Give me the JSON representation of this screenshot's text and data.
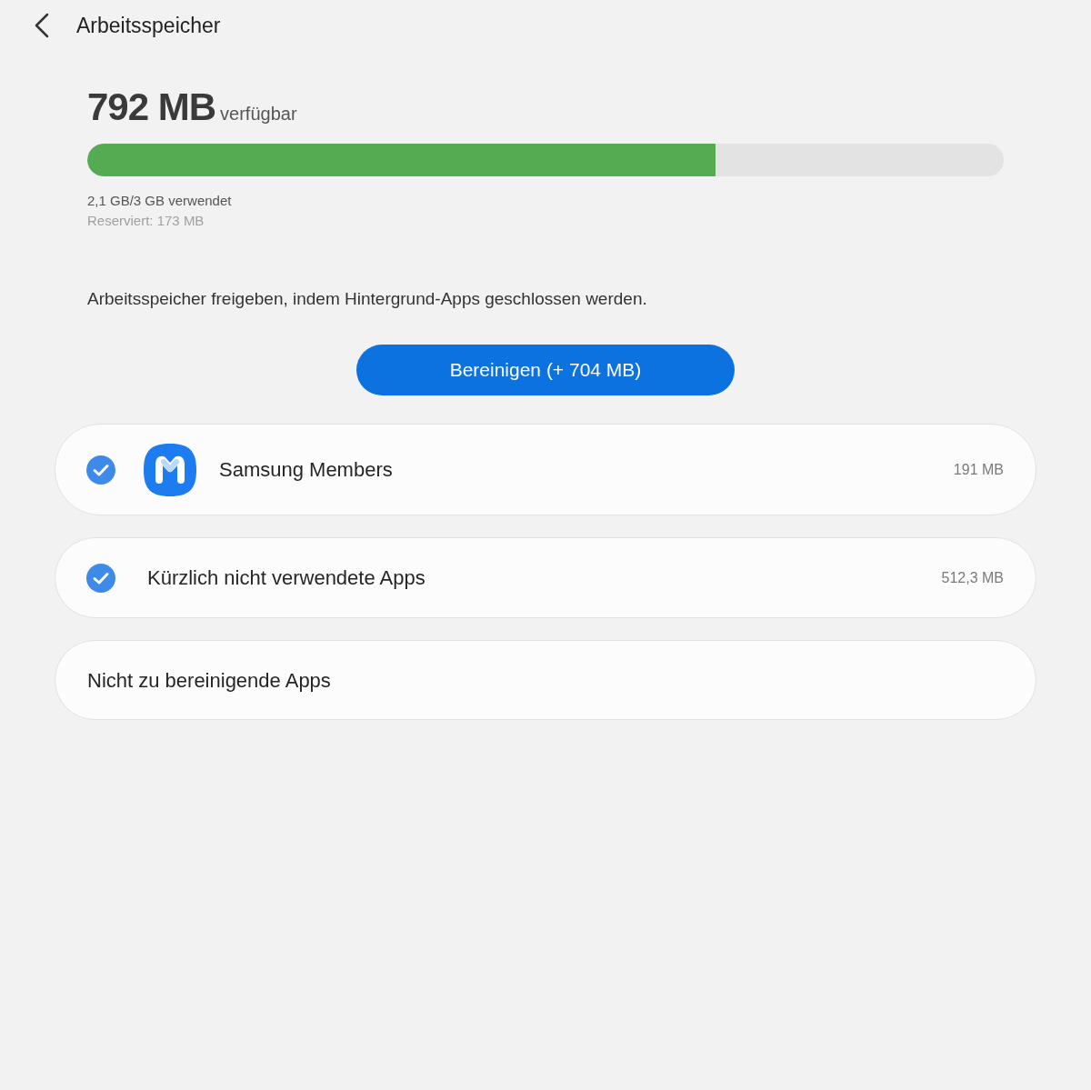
{
  "header": {
    "title": "Arbeitsspeicher"
  },
  "memory": {
    "available": "792 MB",
    "available_label": "verfügbar",
    "level": 0.686,
    "used": "2,1 GB/3 GB verwendet",
    "reserved": "Reserviert: 173 MB"
  },
  "description": "Arbeitsspeicher freigeben, indem Hintergrund-Apps geschlossen werden.",
  "clean_button": {
    "label": "Bereinigen (+ 704 MB)"
  },
  "items": [
    {
      "kind": "app",
      "name": "Samsung Members",
      "size": "191 MB",
      "checked": true
    },
    {
      "kind": "group",
      "name": "Kürzlich nicht verwendete Apps",
      "size": "512,3 MB",
      "checked": true
    },
    {
      "kind": "link",
      "name": "Nicht zu bereinigende Apps"
    }
  ]
}
